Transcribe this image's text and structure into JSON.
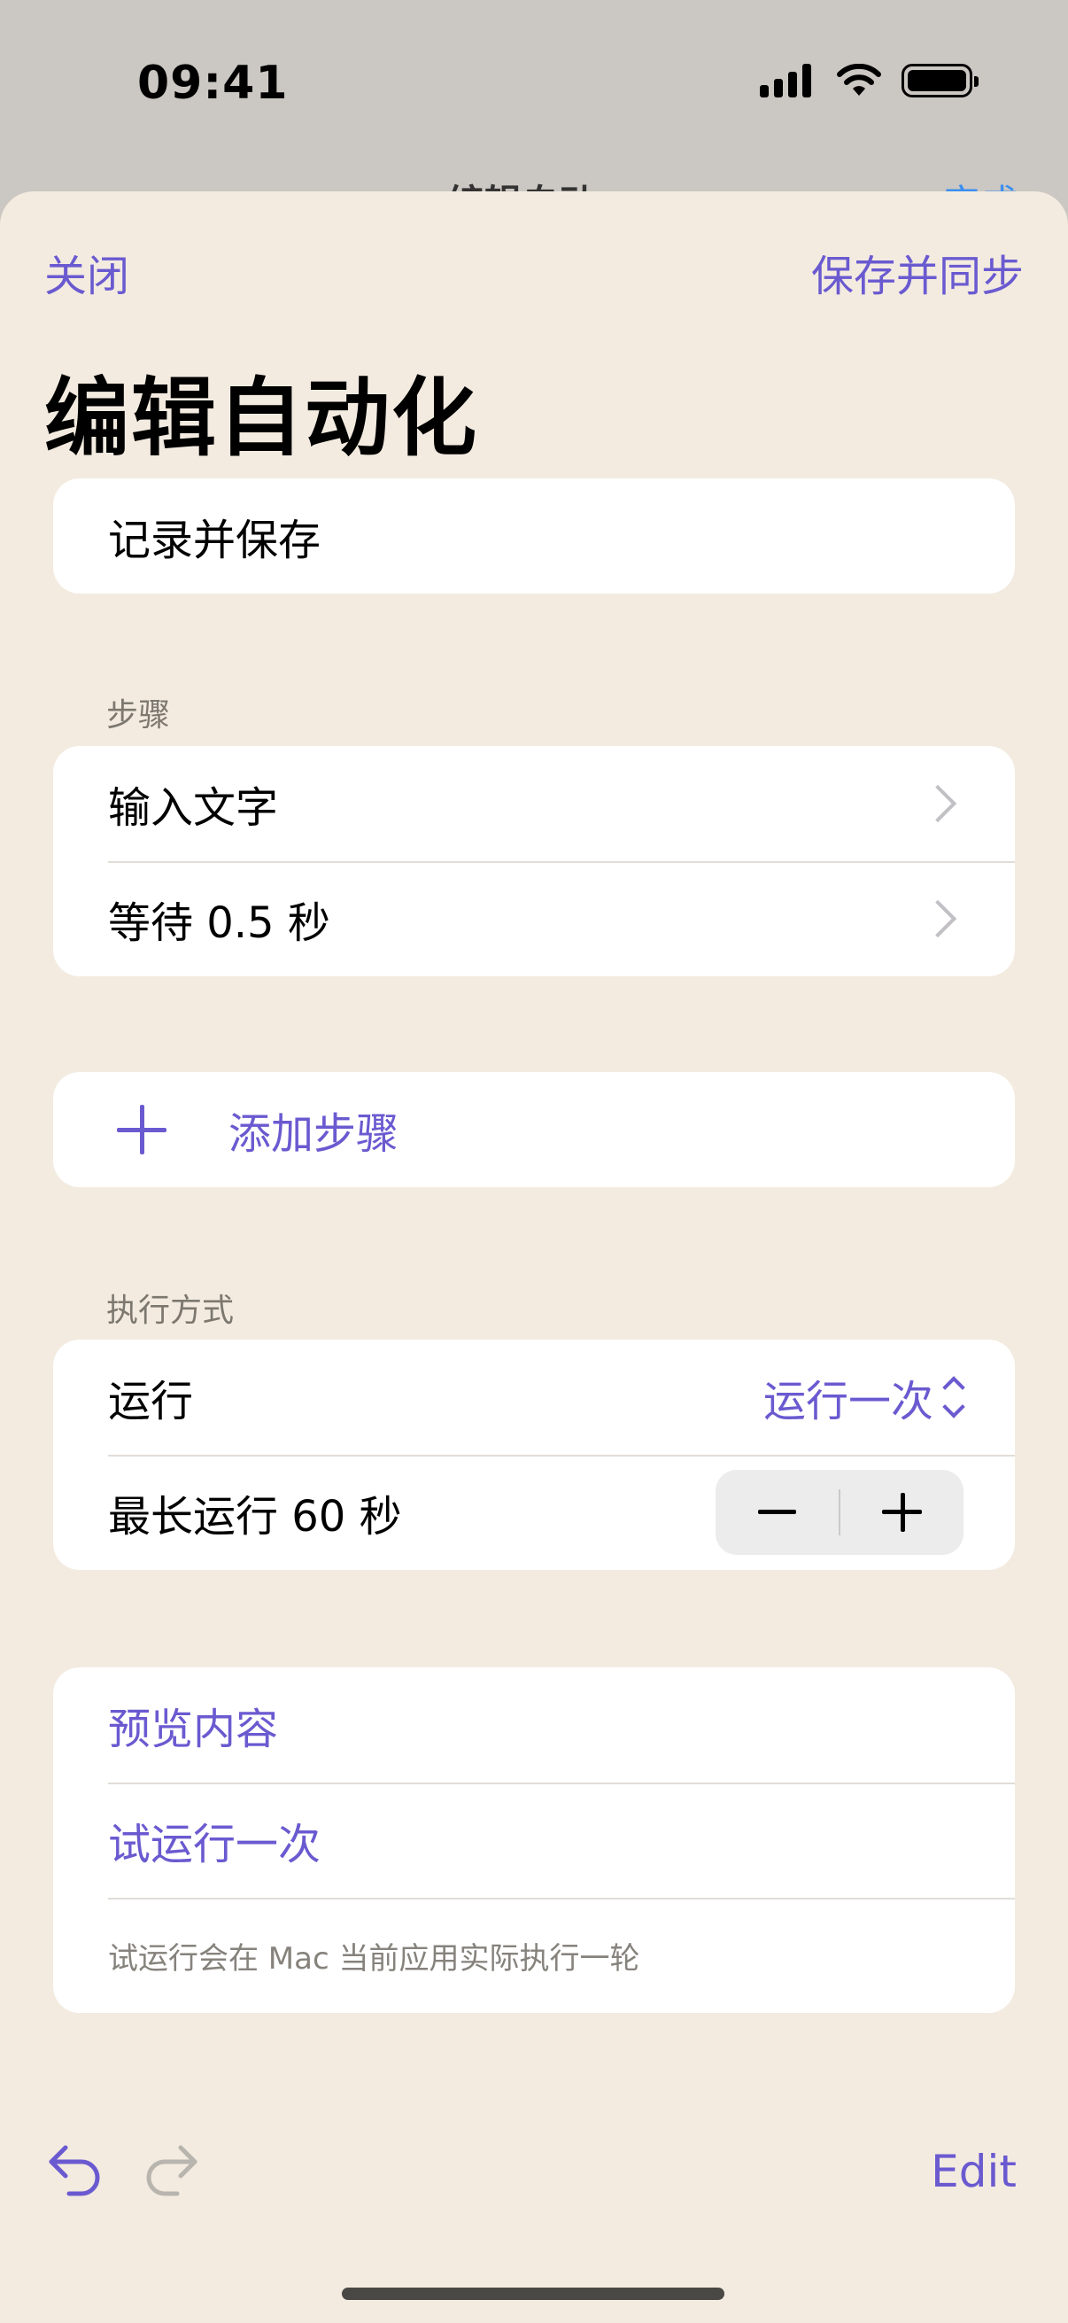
{
  "status_bar": {
    "time": "09:41"
  },
  "behind": {
    "title": "编辑自动",
    "action": "完成"
  },
  "header": {
    "close_label": "关闭",
    "save_label": "保存并同步",
    "title": "编辑自动化"
  },
  "name_field": {
    "value": "记录并保存"
  },
  "steps_section": {
    "header": "步骤",
    "items": [
      {
        "label": "输入文字"
      },
      {
        "label": "等待 0.5 秒"
      }
    ],
    "add_label": "添加步骤"
  },
  "execution_section": {
    "header": "执行方式",
    "run_label": "运行",
    "run_value": "运行一次",
    "max_label": "最长运行 60 秒"
  },
  "actions_section": {
    "preview_label": "预览内容",
    "trial_label": "试运行一次",
    "footnote": "试运行会在 Mac 当前应用实际执行一轮"
  },
  "toolbar": {
    "edit_label": "Edit"
  },
  "colors": {
    "accent": "#6a5ad0",
    "sheet_bg": "#f3ebe0",
    "card_bg": "#ffffff",
    "secondary_text": "#7c7870"
  },
  "icons": [
    "signal-icon",
    "wifi-icon",
    "battery-icon",
    "chevron-right-icon",
    "plus-icon",
    "updown-icon",
    "minus-icon",
    "undo-icon",
    "redo-icon"
  ]
}
